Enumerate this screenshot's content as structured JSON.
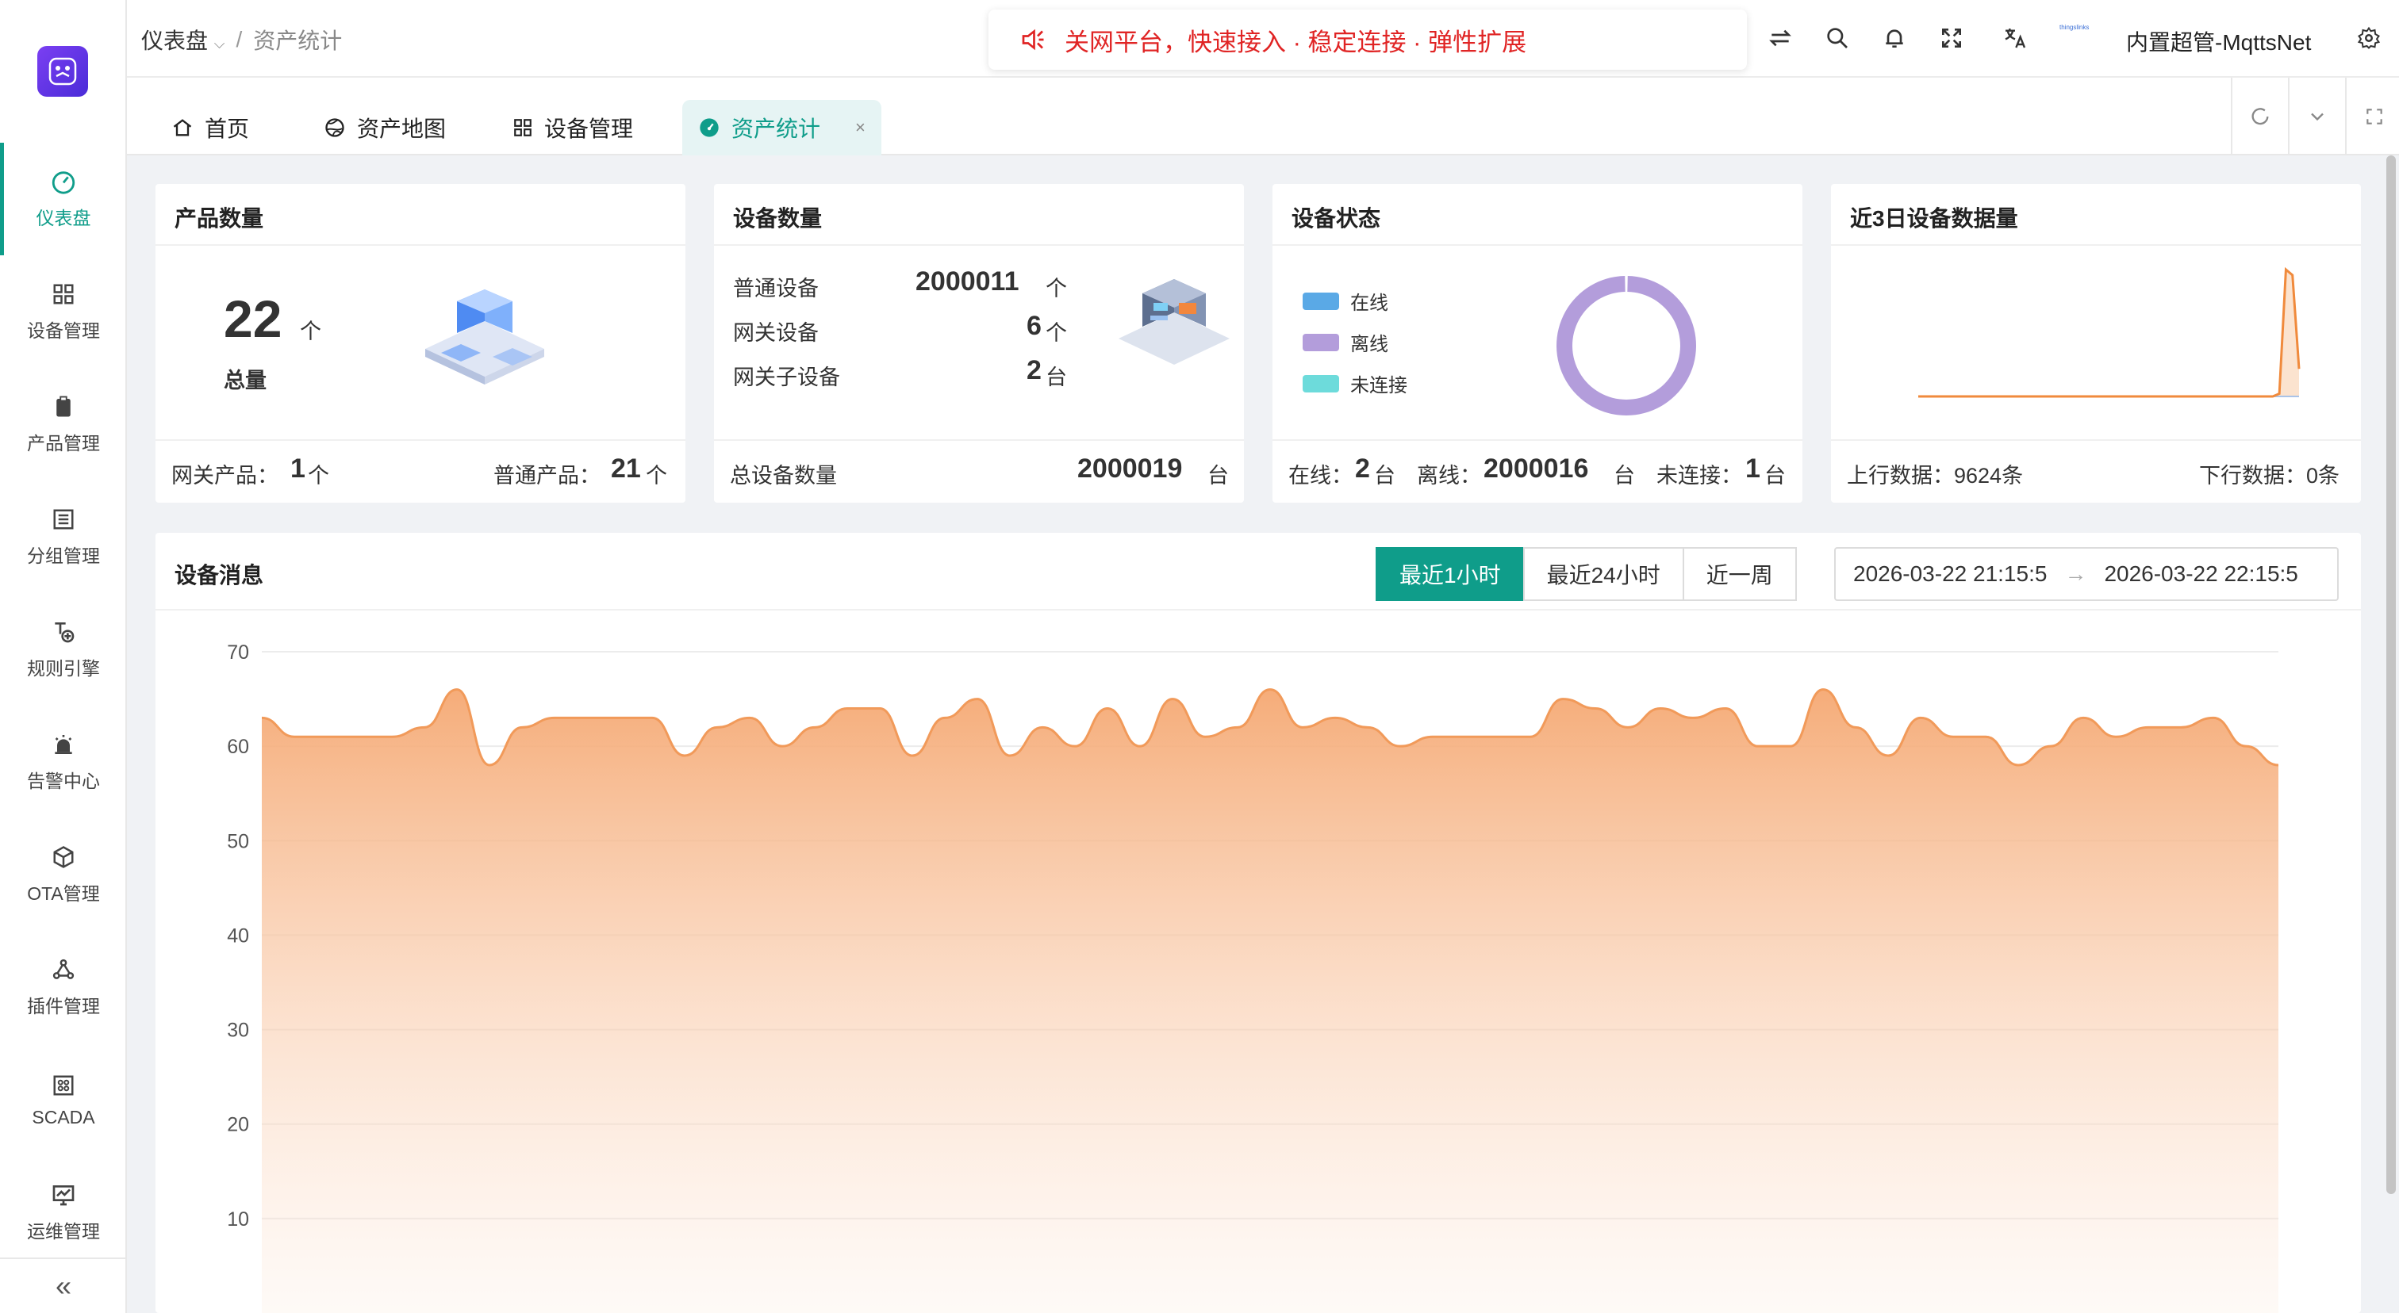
{
  "sidebar": {
    "logo": "logo-icon",
    "items": [
      {
        "label": "仪表盘",
        "icon": "dashboard-icon",
        "active": true
      },
      {
        "label": "设备管理",
        "icon": "grid-icon"
      },
      {
        "label": "产品管理",
        "icon": "clipboard-icon"
      },
      {
        "label": "分组管理",
        "icon": "group-icon"
      },
      {
        "label": "规则引擎",
        "icon": "rule-icon"
      },
      {
        "label": "告警中心",
        "icon": "alarm-icon"
      },
      {
        "label": "OTA管理",
        "icon": "box-icon"
      },
      {
        "label": "插件管理",
        "icon": "plugin-icon"
      },
      {
        "label": "SCADA",
        "icon": "scada-icon"
      },
      {
        "label": "运维管理",
        "icon": "monitor-icon"
      }
    ],
    "collapse_label": "«"
  },
  "header": {
    "breadcrumb_root": "仪表盘",
    "breadcrumb_sep": "/",
    "breadcrumb_current": "资产统计",
    "notice": "关网平台，快速接入 · 稳定连接 · 弹性扩展",
    "avatar_text": "thingslinks",
    "username": "内置超管-MqttsNet"
  },
  "tabs": [
    {
      "label": "首页",
      "icon": "home-icon"
    },
    {
      "label": "资产地图",
      "icon": "map-icon"
    },
    {
      "label": "设备管理",
      "icon": "grid-icon"
    },
    {
      "label": "资产统计",
      "icon": "gauge-icon",
      "active": true,
      "close": "×"
    }
  ],
  "cards": {
    "product": {
      "title": "产品数量",
      "total": "22",
      "total_unit": "个",
      "total_label": "总量",
      "gateway_label": "网关产品：",
      "gateway_value": "1",
      "gateway_unit": "个",
      "normal_label": "普通产品：",
      "normal_value": "21",
      "normal_unit": "个"
    },
    "device": {
      "title": "设备数量",
      "rows": [
        {
          "label": "普通设备",
          "value": "2000011",
          "unit": "个"
        },
        {
          "label": "网关设备",
          "value": "6",
          "unit": "个"
        },
        {
          "label": "网关子设备",
          "value": "2",
          "unit": "台"
        }
      ],
      "total_label": "总设备数量",
      "total_value": "2000019",
      "total_unit": "台"
    },
    "status": {
      "title": "设备状态",
      "legend": [
        {
          "label": "在线",
          "color": "#5aa9e6"
        },
        {
          "label": "离线",
          "color": "#b39ddb"
        },
        {
          "label": "未连接",
          "color": "#6ddbdb"
        }
      ],
      "online_label": "在线：",
      "online_value": "2",
      "online_unit": "台",
      "offline_label": "离线：",
      "offline_value": "2000016",
      "offline_unit": "台",
      "unconnected_label": "未连接：",
      "unconnected_value": "1",
      "unconnected_unit": "台"
    },
    "traffic": {
      "title": "近3日设备数据量",
      "up_label": "上行数据：9624条",
      "down_label": "下行数据：0条"
    }
  },
  "messages": {
    "title": "设备消息",
    "ranges": [
      "最近1小时",
      "最近24小时",
      "近一周"
    ],
    "active_range": 0,
    "date_start": "2026-03-22 21:15:5",
    "date_end": "2026-03-22 22:15:5",
    "date_arrow": "→"
  },
  "colors": {
    "accent": "#0f9d8a",
    "area": "#f5a872",
    "donut_offline": "#b39ddb",
    "notice": "#e02424"
  },
  "chart_data": [
    {
      "type": "pie",
      "categories": [
        "在线",
        "离线",
        "未连接"
      ],
      "values": [
        2,
        2000016,
        1
      ]
    },
    {
      "type": "area",
      "title": "",
      "ylim": [
        0,
        70
      ],
      "yticks": [
        10,
        20,
        30,
        40,
        50,
        60,
        70
      ],
      "grid": true,
      "values": [
        63,
        61,
        61,
        61,
        61,
        62,
        66,
        58,
        62,
        63,
        63,
        63,
        63,
        59,
        62,
        63,
        60,
        62,
        64,
        64,
        59,
        63,
        65,
        59,
        62,
        60,
        64,
        60,
        65,
        61,
        62,
        66,
        62,
        63,
        62,
        60,
        61,
        61,
        61,
        61,
        65,
        64,
        62,
        64,
        63,
        64,
        60,
        60,
        66,
        62,
        59,
        63,
        61,
        61,
        58,
        60,
        63,
        61,
        62,
        62,
        63,
        60,
        58
      ],
      "xlabel": "",
      "ylabel": ""
    },
    {
      "type": "area",
      "title": "",
      "values": [
        0,
        0,
        0,
        0,
        0,
        0,
        0,
        0,
        0,
        0,
        0,
        0,
        0,
        0,
        0,
        0,
        0,
        0,
        0,
        0,
        0,
        0,
        0,
        0,
        0,
        0,
        0,
        0,
        0,
        0,
        0,
        0,
        0,
        0,
        0,
        0,
        0,
        0,
        0,
        0,
        0,
        0,
        0,
        0,
        0,
        0,
        0,
        0,
        0,
        0,
        0,
        0,
        0,
        0,
        0,
        2,
        92,
        88,
        20
      ]
    }
  ]
}
